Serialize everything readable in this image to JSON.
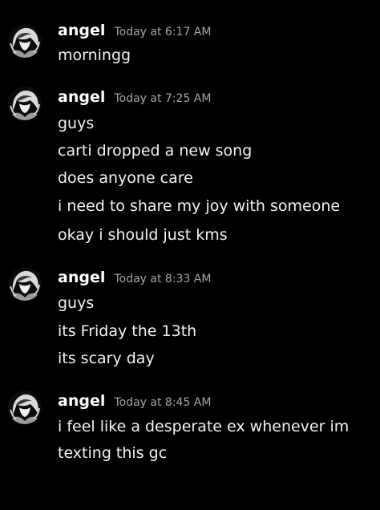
{
  "colors": {
    "background": "#000000",
    "author": "#ffffff",
    "timestamp": "#a3a6aa",
    "message_text": "#f2f3f5"
  },
  "messages": [
    {
      "author": "angel",
      "time": "Today at 6:17 AM",
      "avatar_icon": "anime-avatar-icon",
      "lines": [
        "morningg"
      ]
    },
    {
      "author": "angel",
      "time": "Today at 7:25 AM",
      "avatar_icon": "anime-avatar-icon",
      "lines": [
        "guys",
        "carti dropped a new song",
        "does anyone care",
        "i need to share my joy with someone",
        "okay i should just kms"
      ]
    },
    {
      "author": "angel",
      "time": "Today at 8:33 AM",
      "avatar_icon": "anime-avatar-icon",
      "lines": [
        "guys",
        "its Friday the 13th",
        "its scary day"
      ]
    },
    {
      "author": "angel",
      "time": "Today at 8:45 AM",
      "avatar_icon": "anime-avatar-icon",
      "lines": [
        "i feel like a desperate ex whenever im",
        "texting this gc"
      ]
    }
  ]
}
